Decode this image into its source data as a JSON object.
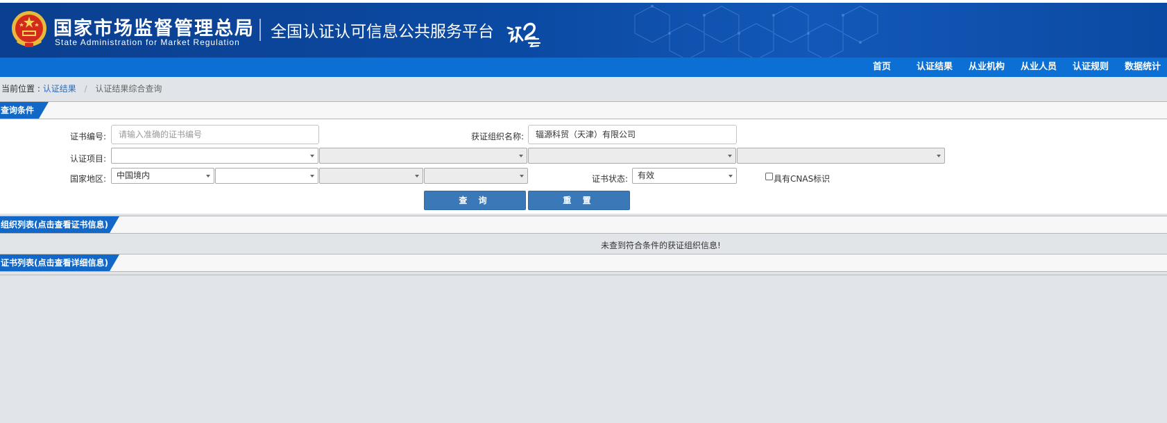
{
  "header": {
    "org_name_cn": "国家市场监督管理总局",
    "org_name_en": "State Administration  for  Market Regulation",
    "platform_title": "全国认证认可信息公共服务平台",
    "platform_logo_icon": "renzheng-yun-logo-icon",
    "emblem_icon": "national-emblem-icon",
    "colors": {
      "header_bg": "#0b4aa3",
      "nav_bg": "#0b6fd4",
      "tab_bg": "#1268c8",
      "button_bg": "#3a78b8"
    }
  },
  "nav": {
    "items": [
      "首页",
      "认证结果",
      "从业机构",
      "从业人员",
      "认证规则",
      "数据统计"
    ]
  },
  "breadcrumb": {
    "prefix": "当前位置 :",
    "link": "认证结果",
    "separator": "/",
    "current": "认证结果综合查询"
  },
  "query_section": {
    "title": "查询条件",
    "cert_no_label": "证书编号:",
    "cert_no_placeholder": "请输入准确的证书编号",
    "cert_no_value": "",
    "org_name_label": "获证组织名称:",
    "org_name_value": "辐源科贸（天津）有限公司",
    "project_label": "认证项目:",
    "project_selects": [
      "",
      "",
      "",
      ""
    ],
    "region_label": "国家地区:",
    "region_selects": [
      "中国境内",
      "",
      "",
      ""
    ],
    "status_label": "证书状态:",
    "status_value": "有效",
    "cnas_label": "具有CNAS标识",
    "cnas_checked": false,
    "query_button": "查 询",
    "reset_button": "重 置"
  },
  "org_list_section": {
    "title": "组织列表(点击查看证书信息)",
    "empty_message": "未查到符合条件的获证组织信息!"
  },
  "cert_list_section": {
    "title": "证书列表(点击查看详细信息)"
  }
}
